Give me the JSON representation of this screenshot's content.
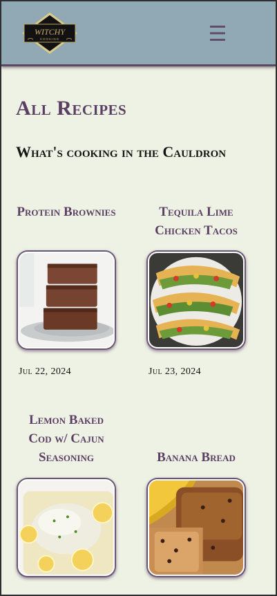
{
  "header": {
    "logo_text": "WITCHY",
    "logo_subtext": "COOKING",
    "menu_icon": "hamburger-menu-icon",
    "menu_glyph": "☰"
  },
  "page": {
    "title": "All Recipes",
    "subtitle": "What's cooking in the Cauldron"
  },
  "recipes": [
    {
      "title": "Protein Brownies",
      "date": "Jul 22, 2024",
      "image": "stacked-brownies"
    },
    {
      "title": "Tequila Lime Chicken Tacos",
      "date": "Jul 23, 2024",
      "image": "chicken-tacos"
    },
    {
      "title": "Lemon Baked Cod w/ Cajun Seasoning",
      "date": "",
      "image": "lemon-cod"
    },
    {
      "title": "Banana Bread",
      "date": "",
      "image": "banana-bread"
    }
  ],
  "colors": {
    "header_bg": "#91a9b5",
    "page_bg": "#eef2e4",
    "accent_purple": "#5a3f63"
  }
}
